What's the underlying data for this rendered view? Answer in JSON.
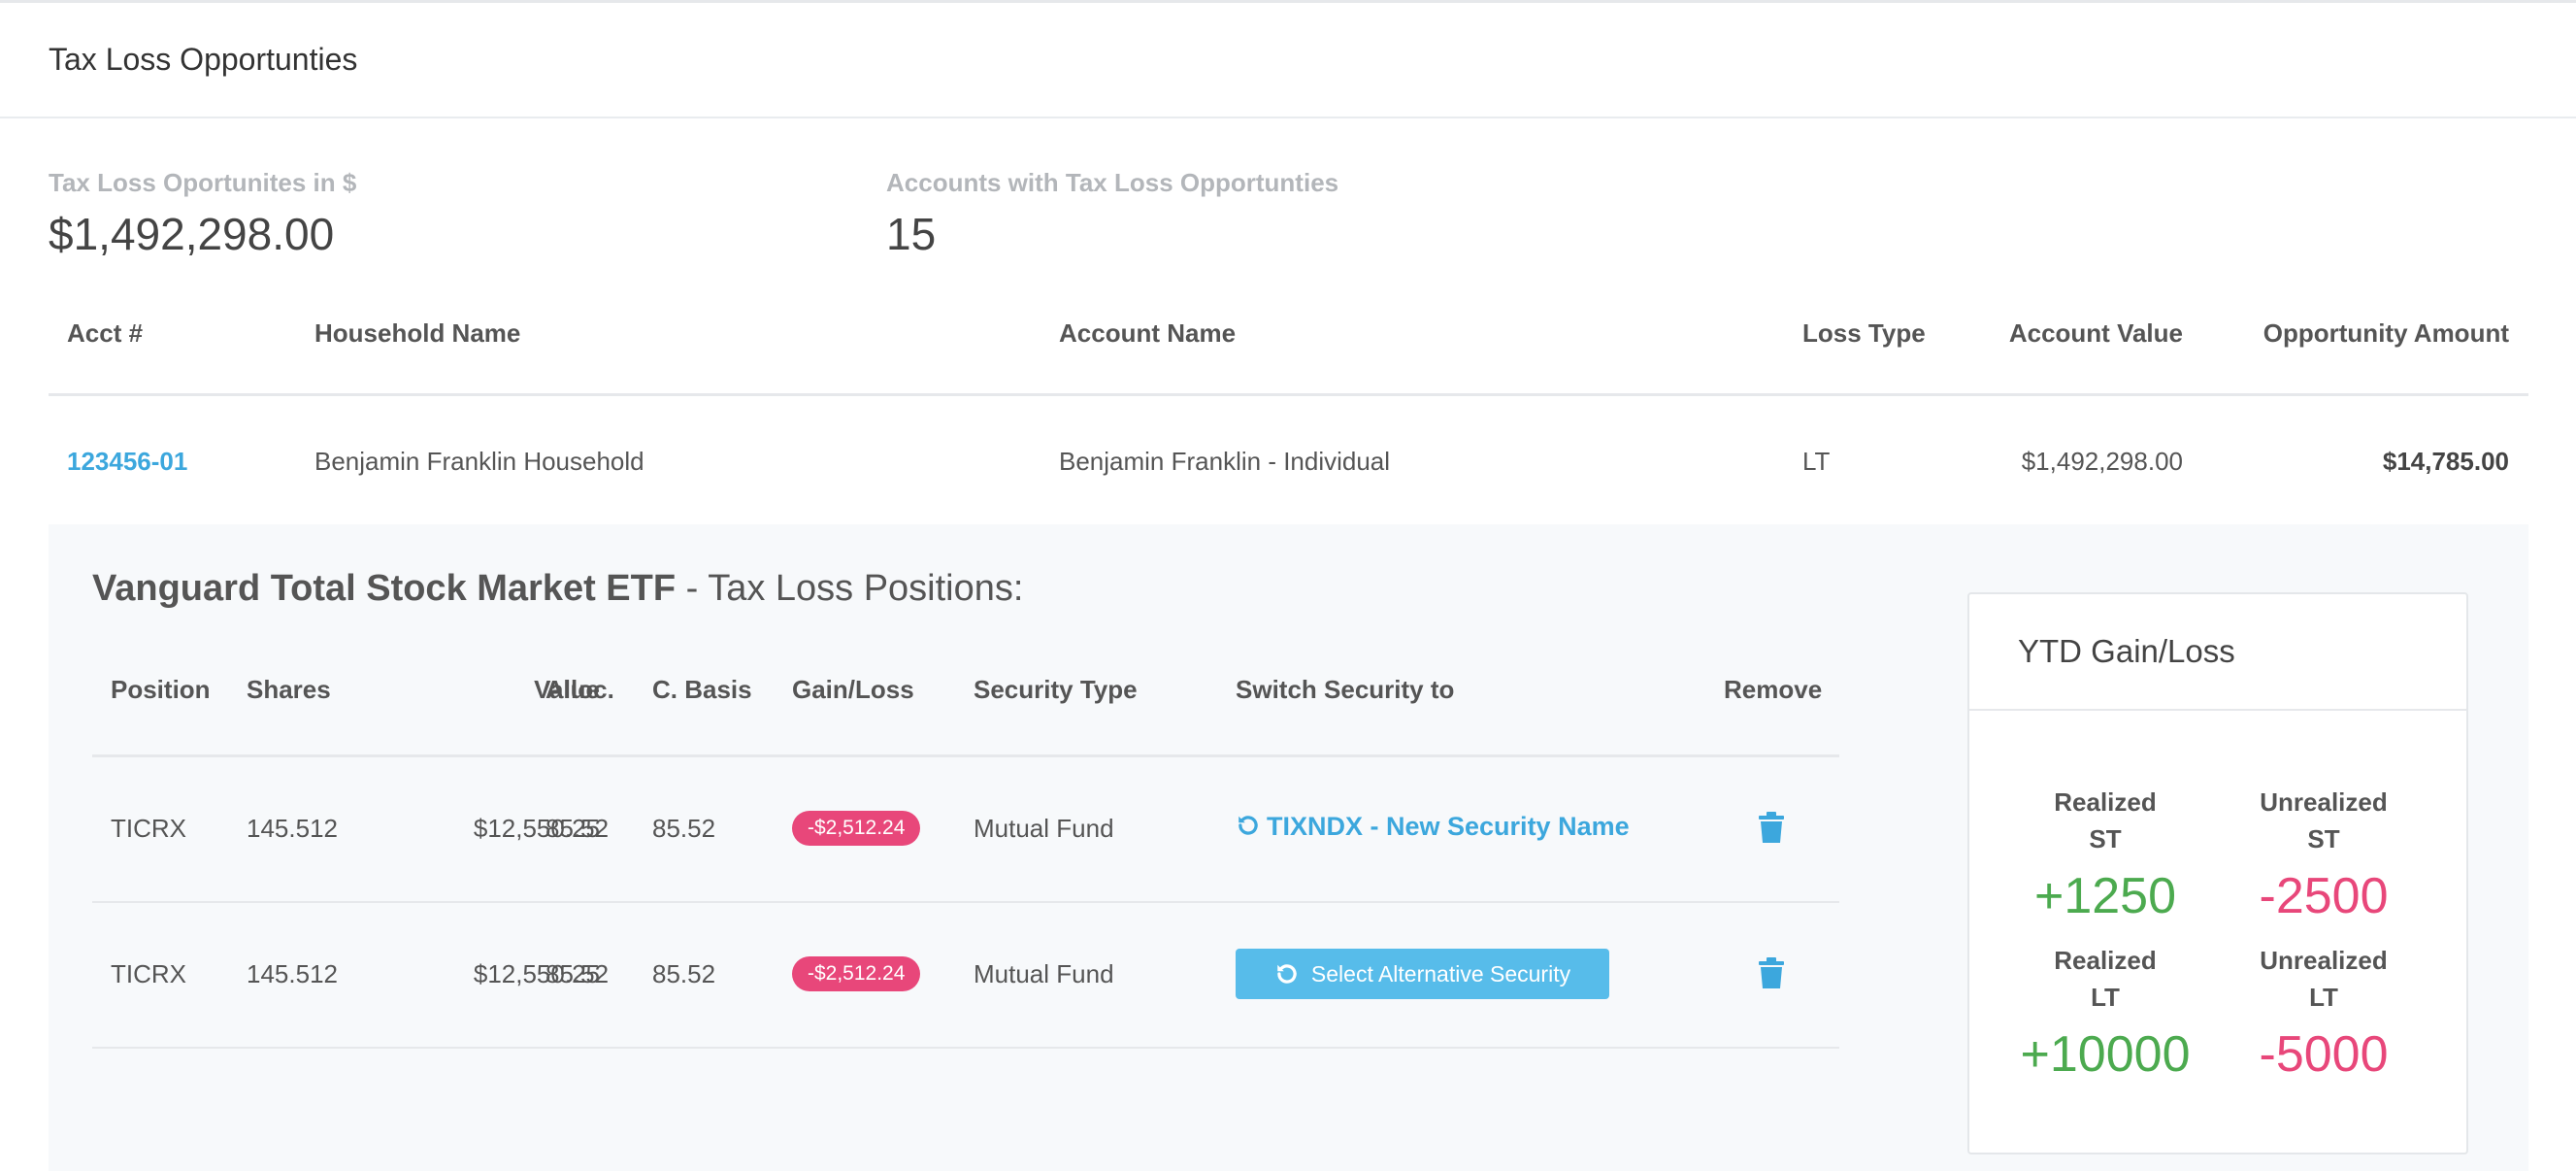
{
  "card": {
    "title": "Tax Loss Opportunties"
  },
  "stats": {
    "total": {
      "label": "Tax Loss Oportunites in $",
      "value": "$1,492,298.00"
    },
    "accounts": {
      "label": "Accounts with Tax Loss Opportunties",
      "value": "15"
    }
  },
  "accounts_table": {
    "headers": [
      "Acct #",
      "Household Name",
      "Account Name",
      "Loss Type",
      "Account Value",
      "Opportunity Amount"
    ],
    "rows": [
      {
        "acct": "123456-01",
        "household": "Benjamin Franklin Household",
        "account": "Benjamin Franklin - Individual",
        "loss_type": "LT",
        "value": "$1,492,298.00",
        "opportunity": "$14,785.00"
      }
    ]
  },
  "detail": {
    "security": "Vanguard Total Stock Market ETF",
    "separator": " - ",
    "suffix": "Tax Loss Positions:",
    "headers": [
      "Position",
      "Shares",
      "Value",
      "Alloc.",
      "C. Basis",
      "Gain/Loss",
      "Security Type",
      "Switch Security to",
      "Remove"
    ],
    "rows": [
      {
        "position": "TICRX",
        "shares": "145.512",
        "value": "$12,550.25",
        "alloc": "85.52",
        "basis": "85.52",
        "gain_loss": "-$2,512.24",
        "type": "Mutual Fund",
        "switch_to": "TIXNDX - New Security Name"
      },
      {
        "position": "TICRX",
        "shares": "145.512",
        "value": "$12,550.25",
        "alloc": "85.52",
        "basis": "85.52",
        "gain_loss": "-$2,512.24",
        "type": "Mutual Fund",
        "switch_button": "Select Alternative Security"
      }
    ]
  },
  "ytd": {
    "title": "YTD Gain/Loss",
    "realized_st": {
      "label1": "Realized",
      "label2": "ST",
      "value": "+1250"
    },
    "unrealized_st": {
      "label1": "Unrealized",
      "label2": "ST",
      "value": "-2500"
    },
    "realized_lt": {
      "label1": "Realized",
      "label2": "LT",
      "value": "+10000"
    },
    "unrealized_lt": {
      "label1": "Unrealized",
      "label2": "LT",
      "value": "-5000"
    }
  },
  "colors": {
    "link": "#3ca7dd",
    "negative": "#e8477a",
    "positive": "#4caa4f",
    "button": "#57bcea"
  },
  "icons": {
    "switch": "refresh-icon",
    "remove": "trash-icon"
  }
}
